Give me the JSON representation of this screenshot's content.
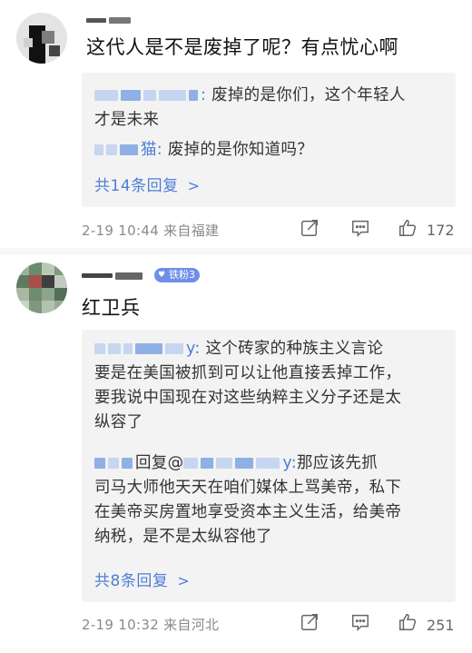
{
  "comments": [
    {
      "text": "这代人是不是废掉了呢？有点忧心啊",
      "replies": [
        {
          "name_suffix": ":",
          "body": "废掉的是你们，这个年轻人",
          "body2": "才是未来"
        },
        {
          "name_suffix": "猫:",
          "body": "废掉的是你知道吗？"
        }
      ],
      "more_label": "共14条回复",
      "date": "2-19 10:44",
      "location": "来自福建",
      "likes": "172"
    },
    {
      "badge": "铁粉3",
      "text": "红卫兵",
      "replies": [
        {
          "name_suffix": "y:",
          "line1": "这个砖家的种族主义言论",
          "line2": "要是在美国被抓到可以让他直接丢掉工作，",
          "line3": "要我说中国现在对这些纳粹主义分子还是太",
          "line4": "纵容了"
        },
        {
          "prefix": "回复@",
          "name_suffix": "y:",
          "line1": "那应该先抓",
          "line2": "司马大师他天天在咱们媒体上骂美帝，私下",
          "line3": "在美帝买房置地享受资本主义生活，给美帝",
          "line4": "纳税，是不是太纵容他了"
        }
      ],
      "more_label": "共8条回复",
      "date": "2-19 10:32",
      "location": "来自河北",
      "likes": "251"
    }
  ],
  "icons": {
    "share": "share-edit-icon",
    "comment": "comment-bubble-icon",
    "like": "thumbs-up-icon",
    "chevron": "chevron-right-icon"
  },
  "colors": {
    "link": "#4f7ed6",
    "badge": "#6e8ee8",
    "meta": "#8a8a8a",
    "reply_bg": "#f3f3f3"
  }
}
